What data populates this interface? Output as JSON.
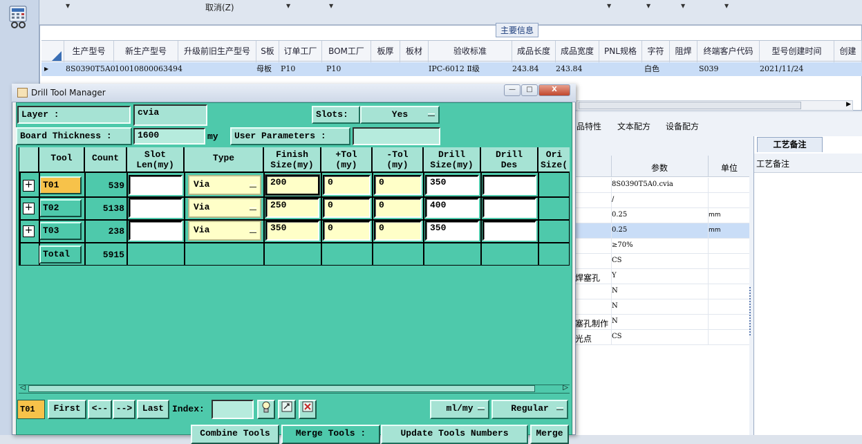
{
  "background_app": {
    "toolbar": {
      "cancel_label": "取消(Z)"
    },
    "main_info_title": "主要信息",
    "grid": {
      "columns": [
        "生产型号",
        "新生产型号",
        "升级前旧生产型号",
        "S板",
        "订单工厂",
        "BOM工厂",
        "板厚",
        "板材",
        "验收标准",
        "成品长度",
        "成品宽度",
        "PNL规格",
        "字符",
        "阻焊",
        "终端客户代码",
        "型号创建时间",
        "创建"
      ],
      "row": {
        "生产型号": "8S0390T5A0",
        "新生产型号": "10010800063494",
        "S板": "母板",
        "订单工厂": "P10",
        "BOM工厂": "P10",
        "验收标准": "IPC-6012 Ⅱ级",
        "成品长度": "243.84",
        "成品宽度": "243.84",
        "阻焊": "白色",
        "终端客户代码": "S039",
        "型号创建时间": "2021/11/24"
      }
    },
    "right_tabs": [
      "品特性",
      "文本配方",
      "设备配方"
    ],
    "params_header": {
      "param": "参数",
      "unit": "单位"
    },
    "params": [
      {
        "label": "",
        "value": "8S0390T5A0.cvia",
        "unit": ""
      },
      {
        "label": "",
        "value": "/",
        "unit": ""
      },
      {
        "label": "",
        "value": "0.25",
        "unit": "mm"
      },
      {
        "label": "",
        "value": "0.25",
        "unit": "mm"
      },
      {
        "label": "",
        "value": "≥70%",
        "unit": ""
      },
      {
        "label": "",
        "value": "CS",
        "unit": ""
      },
      {
        "label": "焊塞孔",
        "value": "Y",
        "unit": ""
      },
      {
        "label": "",
        "value": "N",
        "unit": ""
      },
      {
        "label": "",
        "value": "N",
        "unit": ""
      },
      {
        "label": "塞孔制作",
        "value": "N",
        "unit": ""
      },
      {
        "label": "光点",
        "value": "CS",
        "unit": ""
      }
    ],
    "craft_tab": "工艺备注",
    "craft_header": "工艺备注"
  },
  "dialog": {
    "title": "Drill Tool Manager",
    "buttons": {
      "minimize": "—",
      "maximize": "□",
      "close": "X"
    },
    "layer_label": "Layer          :",
    "layer_value": "cvia",
    "slots_label": "Slots:",
    "slots_value": "Yes",
    "board_thickness_label": "Board Thickness :",
    "board_thickness_value": "1600",
    "board_thickness_unit": "my",
    "user_params_label": "User Parameters :",
    "user_params_value": "",
    "columns": [
      "Tool",
      "Count",
      "Slot\nLen(my)",
      "Type",
      "Finish\nSize(my)",
      "+Tol\n(my)",
      "-Tol\n(my)",
      "Drill\nSize(my)",
      "Drill\nDes",
      "Ori\nSize("
    ],
    "tools": [
      {
        "expand": "+",
        "tool": "T01",
        "count": "539",
        "slot_len": "",
        "type": "Via",
        "finish": "200",
        "plus_tol": "0",
        "minus_tol": "0",
        "drill": "350",
        "des": ""
      },
      {
        "expand": "+",
        "tool": "T02",
        "count": "5138",
        "slot_len": "",
        "type": "Via",
        "finish": "250",
        "plus_tol": "0",
        "minus_tol": "0",
        "drill": "400",
        "des": ""
      },
      {
        "expand": "+",
        "tool": "T03",
        "count": "238",
        "slot_len": "",
        "type": "Via",
        "finish": "350",
        "plus_tol": "0",
        "minus_tol": "0",
        "drill": "350",
        "des": ""
      }
    ],
    "total_label": "Total",
    "total_count": "5915",
    "nav": {
      "current": "T01",
      "first": "First",
      "prev": "<--",
      "next": "-->",
      "last": "Last",
      "index_label": "Index:",
      "index_value": "",
      "units": "ml/my",
      "mode": "Regular"
    },
    "bottom_buttons": [
      "Combine Tools",
      "Merge Tools :",
      "Update Tools Numbers",
      "Merge"
    ],
    "selected_tool_color": "#f7c24a",
    "accent_color": "#4ec9ab"
  }
}
